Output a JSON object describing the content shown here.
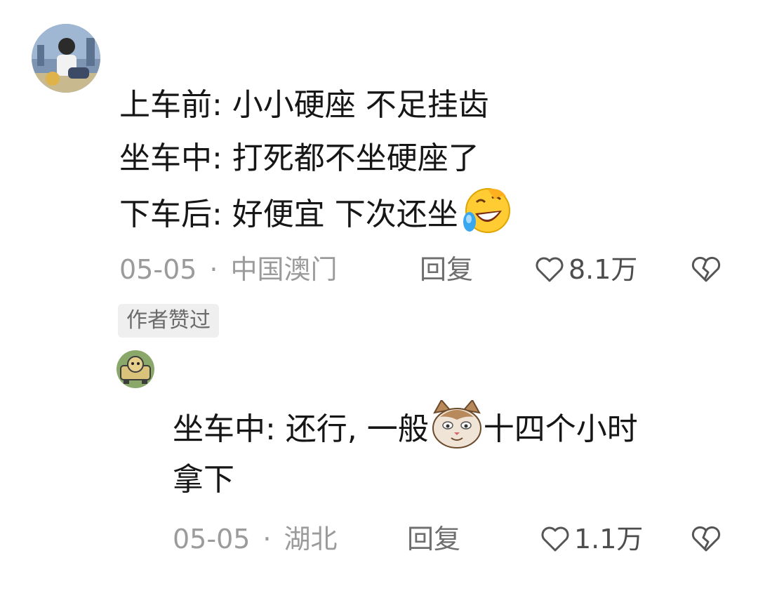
{
  "comments": [
    {
      "lines": [
        "上车前: 小小硬座 不足挂齿",
        "坐车中: 打死都不坐硬座了",
        "下车后: 好便宜 下次还坐"
      ],
      "date": "05-05",
      "location": "中国澳门",
      "reply_label": "回复",
      "likes": "8.1万",
      "emoji": "laughing-crying-emoji",
      "badge": "作者赞过"
    },
    {
      "lines": [
        "坐车中: 还行, 一般",
        "拿下"
      ],
      "line1_tail": "十四个小时",
      "date": "05-05",
      "location": "湖北",
      "reply_label": "回复",
      "likes": "1.1万",
      "emoji": "cat-face-emoji"
    }
  ],
  "colors": {
    "meta_text": "#9b9b9b",
    "reply_text": "#6e6e6e",
    "badge_bg": "#efefef"
  }
}
